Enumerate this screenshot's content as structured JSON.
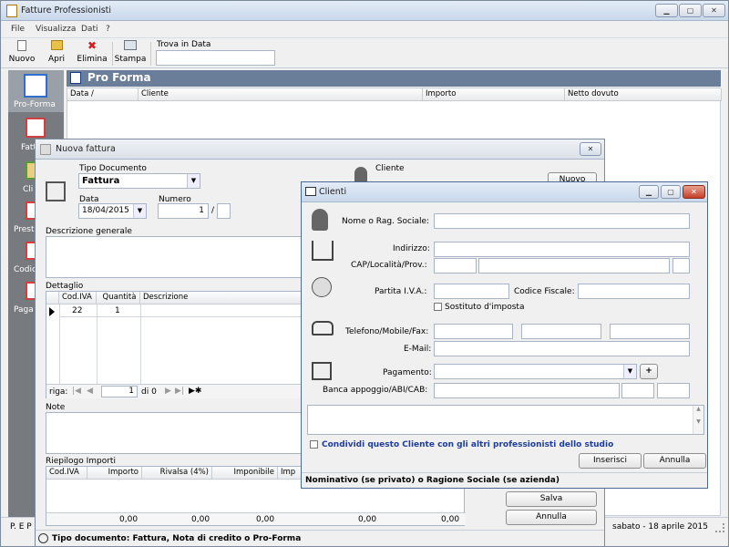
{
  "main_window": {
    "title": "Fatture Professionisti",
    "menu": [
      "File",
      "Visualizza",
      "Dati",
      "?"
    ],
    "toolbar": {
      "nuovo": "Nuovo",
      "apri": "Apri",
      "elimina": "Elimina",
      "stampa": "Stampa",
      "search_label": "Trova in Data",
      "search_value": ""
    },
    "sidebar": {
      "items": [
        {
          "label": "Pro-Forma"
        },
        {
          "label": "Fatt"
        },
        {
          "label": "Cli"
        },
        {
          "label": "Prest"
        },
        {
          "label": "Codic"
        },
        {
          "label": "Paga"
        }
      ]
    },
    "section_title": "Pro Forma",
    "columns": [
      "Data /",
      "Cliente",
      "Importo",
      "Netto dovuto"
    ],
    "status_left": "P. E P",
    "status_right": "sabato - 18 aprile 2015"
  },
  "nuova_fattura": {
    "title": "Nuova fattura",
    "tipo_documento_label": "Tipo Documento",
    "tipo_documento_value": "Fattura",
    "cliente_label": "Cliente",
    "cliente_value": "",
    "nuovo_button": "Nuovo",
    "data_label": "Data",
    "data_value": "18/04/2015",
    "numero_label": "Numero",
    "numero_value": "1",
    "numero_sep": "/",
    "descrizione_label": "Descrizione generale",
    "dettaglio_label": "Dettaglio",
    "dettaglio_columns": [
      "Cod.IVA",
      "Quantità",
      "Descrizione"
    ],
    "dettaglio_rows": [
      {
        "cod_iva": "22",
        "quantita": "1",
        "descrizione": ""
      }
    ],
    "nav_riga_label": "riga:",
    "nav_current": "1",
    "nav_di": "di 0",
    "note_label": "Note",
    "riepilogo_label": "Riepilogo Importi",
    "riepilogo_columns": [
      "Cod.IVA",
      "Importo",
      "Rivalsa (4%)",
      "Imponibile",
      "Imp"
    ],
    "riepilogo_totals": [
      "0,00",
      "0,00",
      "0,00",
      "0,00",
      "0,00"
    ],
    "salva_button": "Salva",
    "annulla_button": "Annulla",
    "hint": "Tipo documento: Fattura, Nota di credito o Pro-Forma"
  },
  "clienti": {
    "title": "Clienti",
    "nome_label": "Nome o Rag. Sociale:",
    "indirizzo_label": "Indirizzo:",
    "cap_label": "CAP/Località/Prov.:",
    "piva_label": "Partita I.V.A.:",
    "cf_label": "Codice Fiscale:",
    "sostituto_label": "Sostituto d'imposta",
    "telefono_label": "Telefono/Mobile/Fax:",
    "email_label": "E-Mail:",
    "pagamento_label": "Pagamento:",
    "pagamento_add": "+",
    "banca_label": "Banca appoggio/ABI/CAB:",
    "condividi_label": "Condividi questo Cliente con gli altri professionisti dello studio",
    "inserisci_button": "Inserisci",
    "annulla_button": "Annulla",
    "hint": "Nominativo (se privato) o Ragione Sociale (se azienda)"
  },
  "colors": {
    "accent": "#1f3d9a",
    "section_bar": "#6b7e99",
    "close_red": "#c4402a"
  }
}
